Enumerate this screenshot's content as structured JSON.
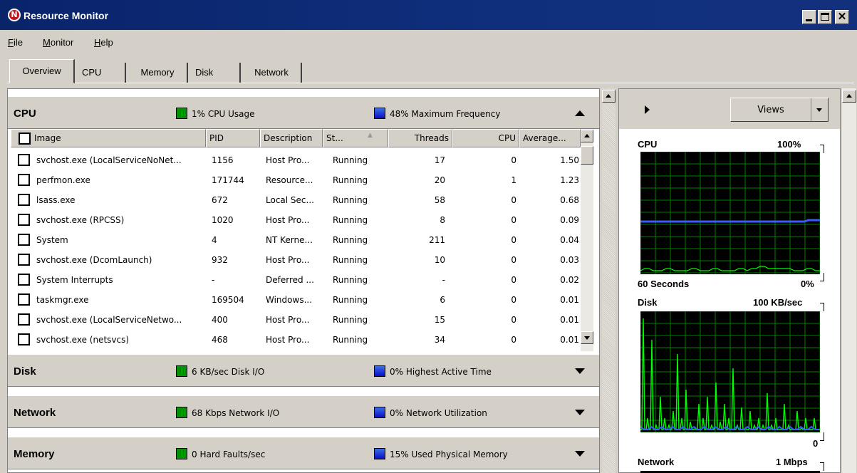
{
  "window": {
    "title": "Resource Monitor",
    "icon": "resource-monitor-icon",
    "controls": {
      "minimize": "_",
      "maximize": "□",
      "close": "✕"
    }
  },
  "menubar": {
    "items": [
      "File",
      "Monitor",
      "Help"
    ]
  },
  "tabs": [
    "Overview",
    "CPU",
    "Memory",
    "Disk",
    "Network"
  ],
  "active_tab": "Overview",
  "sections": {
    "cpu": {
      "title": "CPU",
      "stat1": "1% CPU Usage",
      "stat2": "48% Maximum Frequency",
      "expanded": true
    },
    "disk": {
      "title": "Disk",
      "stat1": "6 KB/sec Disk I/O",
      "stat2": "0% Highest Active Time",
      "expanded": false
    },
    "network": {
      "title": "Network",
      "stat1": "68 Kbps Network I/O",
      "stat2": "0% Network Utilization",
      "expanded": false
    },
    "memory": {
      "title": "Memory",
      "stat1": "0 Hard Faults/sec",
      "stat2": "15% Used Physical Memory",
      "expanded": false
    }
  },
  "cpu_table": {
    "columns": [
      "Image",
      "PID",
      "Description",
      "St...",
      "Threads",
      "CPU",
      "Average..."
    ],
    "rows": [
      [
        "svchost.exe (LocalServiceNoNet...",
        "1156",
        "Host Pro...",
        "Running",
        "17",
        "0",
        "1.50"
      ],
      [
        "perfmon.exe",
        "171744",
        "Resource...",
        "Running",
        "20",
        "1",
        "1.23"
      ],
      [
        "lsass.exe",
        "672",
        "Local Sec...",
        "Running",
        "58",
        "0",
        "0.68"
      ],
      [
        "svchost.exe (RPCSS)",
        "1020",
        "Host Pro...",
        "Running",
        "8",
        "0",
        "0.09"
      ],
      [
        "System",
        "4",
        "NT Kerne...",
        "Running",
        "211",
        "0",
        "0.04"
      ],
      [
        "svchost.exe (DcomLaunch)",
        "932",
        "Host Pro...",
        "Running",
        "10",
        "0",
        "0.03"
      ],
      [
        "System Interrupts",
        "-",
        "Deferred ...",
        "Running",
        "-",
        "0",
        "0.02"
      ],
      [
        "taskmgr.exe",
        "169504",
        "Windows...",
        "Running",
        "6",
        "0",
        "0.01"
      ],
      [
        "svchost.exe (LocalServiceNetwo...",
        "400",
        "Host Pro...",
        "Running",
        "15",
        "0",
        "0.01"
      ],
      [
        "svchost.exe (netsvcs)",
        "468",
        "Host Pro...",
        "Running",
        "34",
        "0",
        "0.01"
      ]
    ]
  },
  "right_panel": {
    "views_label": "Views",
    "cpu_graph": {
      "title": "CPU",
      "max": "100%",
      "time": "60 Seconds",
      "min": "0%"
    },
    "disk_graph": {
      "title": "Disk",
      "max": "100 KB/sec",
      "min": "0"
    },
    "network_graph": {
      "title": "Network",
      "max": "1 Mbps"
    }
  },
  "colors": {
    "graph_green": "#00ff00",
    "graph_blue": "#3a5cff",
    "grid": "#008000"
  }
}
